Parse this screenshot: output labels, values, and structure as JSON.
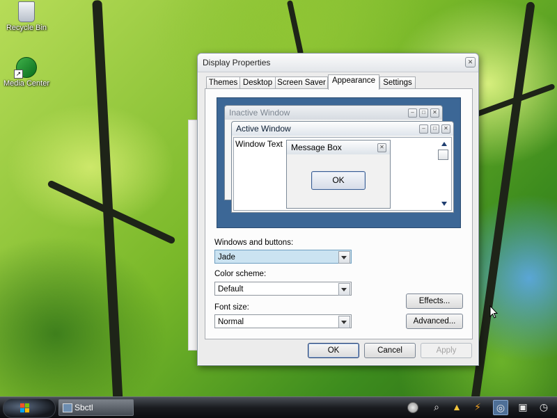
{
  "desktop": {
    "icons": [
      {
        "label": "Recycle Bin",
        "icon": "recycle-bin-icon"
      },
      {
        "label": "Media Center",
        "icon": "media-center-icon"
      }
    ]
  },
  "dialog": {
    "title": "Display Properties",
    "close_glyph": "✕",
    "tabs": [
      "Themes",
      "Desktop",
      "Screen Saver",
      "Appearance",
      "Settings"
    ],
    "active_tab": "Appearance",
    "preview": {
      "inactive_window_title": "Inactive Window",
      "active_window_title": "Active Window",
      "window_text": "Window Text",
      "message_box_title": "Message Box",
      "message_box_ok": "OK",
      "background_color": "#3c6796"
    },
    "windows_and_buttons": {
      "label": "Windows and buttons:",
      "value": "Jade"
    },
    "color_scheme": {
      "label": "Color scheme:",
      "value": "Default"
    },
    "font_size": {
      "label": "Font size:",
      "value": "Normal"
    },
    "effects_button": "Effects...",
    "advanced_button": "Advanced...",
    "ok_button": "OK",
    "cancel_button": "Cancel",
    "apply_button": "Apply"
  },
  "taskbar": {
    "task_label": "Sbctl",
    "tray_icons": [
      "search-icon",
      "bell-icon",
      "power-icon",
      "network-icon",
      "display-icon",
      "clock-icon"
    ]
  }
}
